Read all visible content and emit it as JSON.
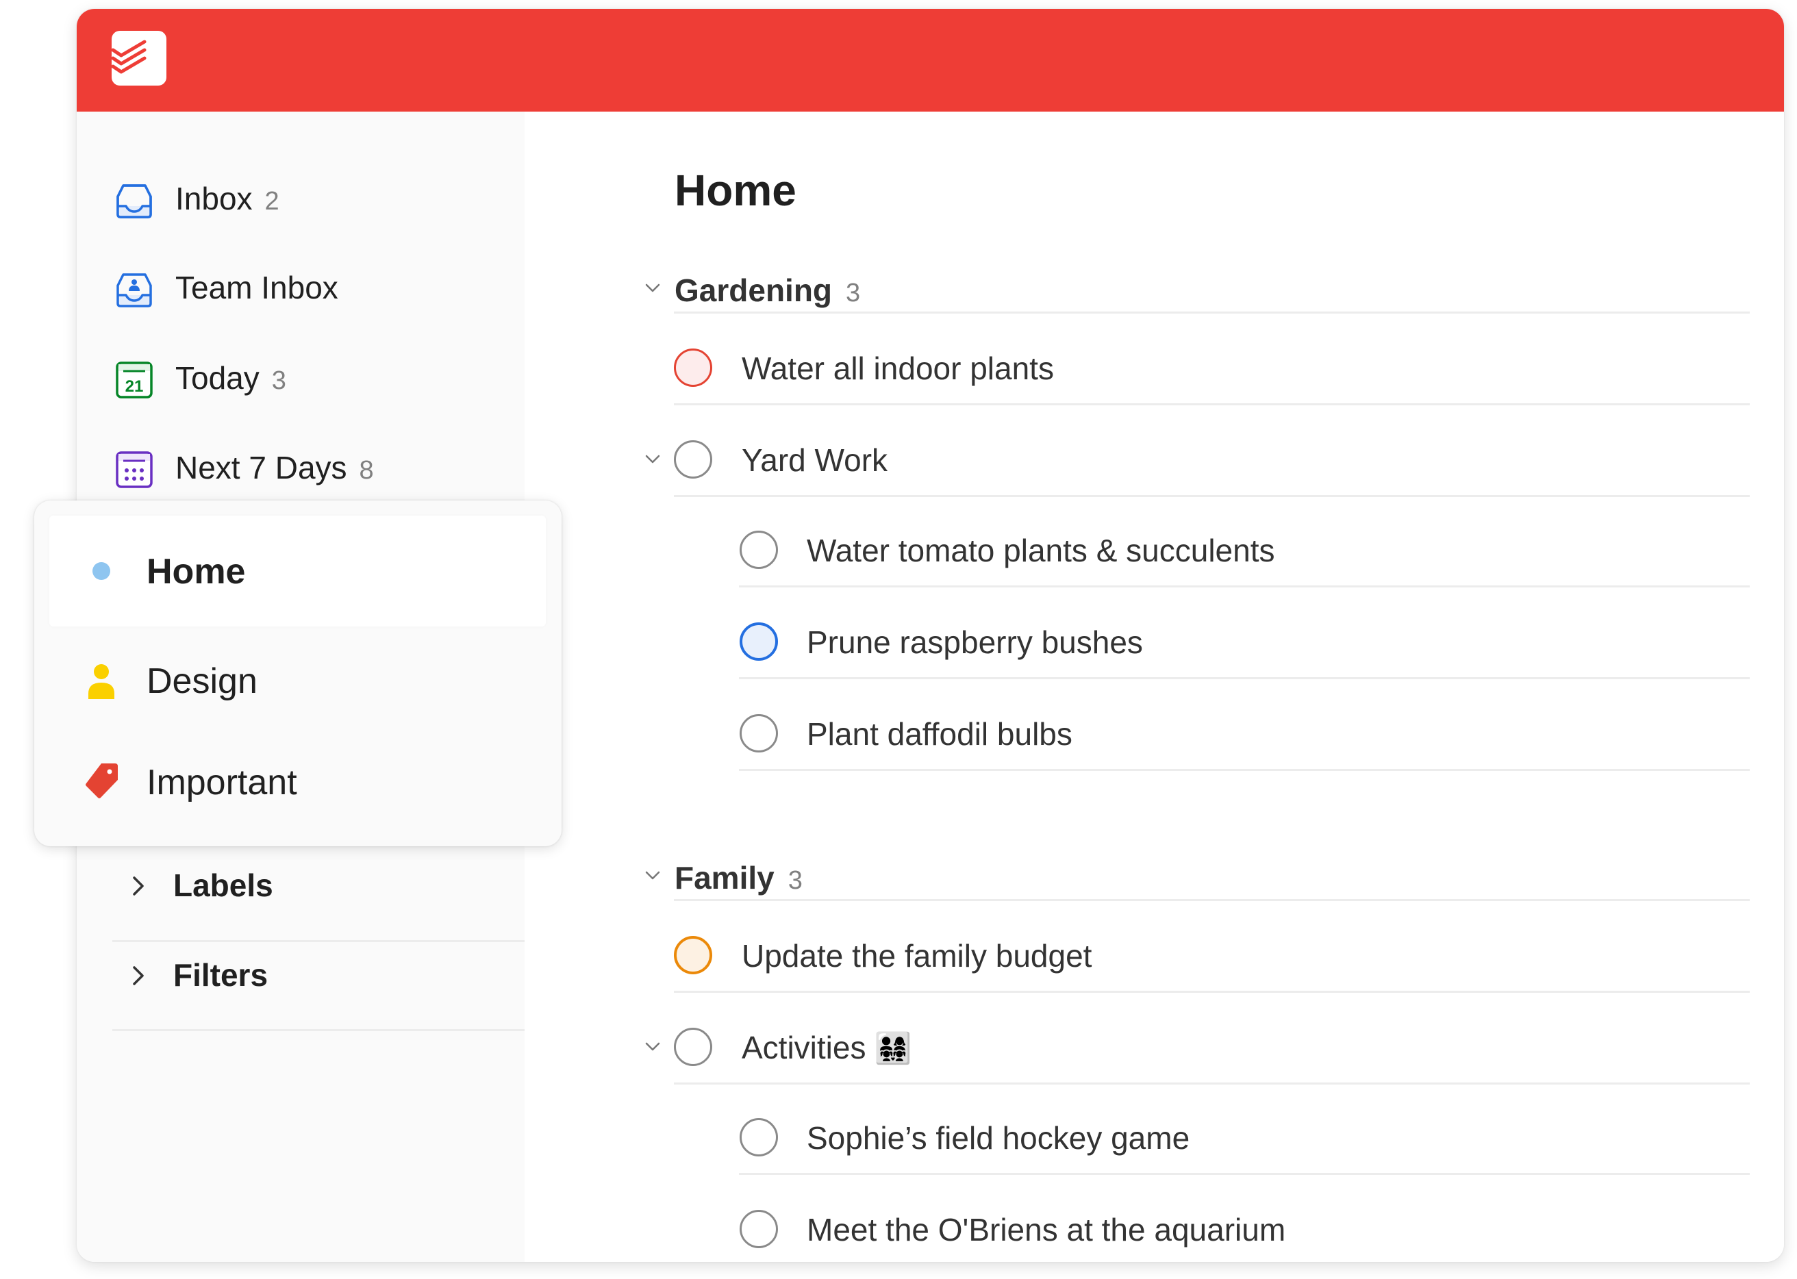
{
  "app": {
    "name": "Todoist",
    "brand_color": "#ee3d36",
    "logo_icon": "todoist-logo-icon"
  },
  "sidebar": {
    "nav_items": [
      {
        "label": "Inbox",
        "count": "2",
        "icon": "inbox-icon",
        "color": "#246fe0"
      },
      {
        "label": "Team Inbox",
        "count": "",
        "icon": "team-inbox-icon",
        "color": "#246fe0"
      },
      {
        "label": "Today",
        "count": "3",
        "icon": "calendar-today-icon",
        "icon_text": "21",
        "color": "#058527"
      },
      {
        "label": "Next 7 Days",
        "count": "8",
        "icon": "calendar-week-icon",
        "color": "#692fc2"
      }
    ],
    "sections": [
      {
        "label": "Labels",
        "icon": "chevron-right-icon"
      },
      {
        "label": "Filters",
        "icon": "chevron-right-icon"
      }
    ]
  },
  "popup": {
    "items": [
      {
        "label": "Home",
        "icon": "project-dot-icon",
        "color": "#7ecc49",
        "dot_color": "#8ec5f0",
        "active": true
      },
      {
        "label": "Design",
        "icon": "person-icon",
        "color": "#fad000",
        "active": false
      },
      {
        "label": "Important",
        "icon": "label-tag-icon",
        "color": "#e44332",
        "active": false
      }
    ]
  },
  "main": {
    "title": "Home",
    "groups": [
      {
        "name": "Gardening",
        "count": "3",
        "tasks": [
          {
            "title": "Water all indoor plants",
            "priority_color": "#e44332",
            "priority_fill": "#fdecec",
            "indent": 0,
            "has_children": false
          },
          {
            "title": "Yard Work",
            "priority_color": "",
            "indent": 0,
            "has_children": true
          },
          {
            "title": "Water tomato plants & succulents",
            "priority_color": "",
            "indent": 1,
            "has_children": false
          },
          {
            "title": "Prune raspberry bushes",
            "priority_color": "#246fe0",
            "priority_fill": "#e8f0fc",
            "indent": 1,
            "has_children": false
          },
          {
            "title": "Plant daffodil bulbs",
            "priority_color": "",
            "indent": 1,
            "has_children": false
          }
        ]
      },
      {
        "name": "Family",
        "count": "3",
        "tasks": [
          {
            "title": "Update the family budget",
            "priority_color": "#eb8909",
            "priority_fill": "#fdf1e3",
            "indent": 0,
            "has_children": false
          },
          {
            "title": "Activities",
            "emoji": "👨‍👩‍👧‍👧",
            "priority_color": "",
            "indent": 0,
            "has_children": true
          },
          {
            "title": "Sophie’s field hockey game",
            "priority_color": "",
            "indent": 1,
            "has_children": false
          },
          {
            "title": "Meet the O'Briens at the aquarium",
            "priority_color": "",
            "indent": 1,
            "has_children": false
          }
        ]
      }
    ]
  }
}
